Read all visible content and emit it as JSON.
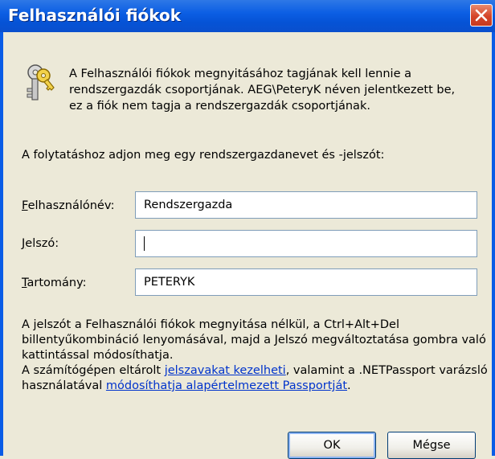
{
  "window": {
    "title": "Felhasználói fiókok"
  },
  "message": "A Felhasználói fiókok megnyitásához tagjának kell lennie a rendszergazdák csoportjának. AEG\\PeteryK néven jelentkezett be, ez a fiók nem tagja a rendszergazdák csoportjának.",
  "prompt": "A folytatáshoz adjon meg egy rendszergazdanevet és -jelszót:",
  "fields": {
    "username": {
      "label_first": "F",
      "label_rest": "elhasználónév:",
      "value": "Rendszergazda"
    },
    "password": {
      "label_first": "J",
      "label_rest": "elszó:",
      "value": ""
    },
    "domain": {
      "label_first": "T",
      "label_rest": "artomány:",
      "value": "PETERYK"
    }
  },
  "info": {
    "line1": "A jelszót a Felhasználói fiókok megnyitása nélkül, a Ctrl+Alt+Del billentyűkombináció lenyomásával, majd a Jelszó megváltoztatása gombra való kattintással módosíthatja.",
    "line2_pre": "A számítógépen eltárolt ",
    "link1": "jelszavakat kezelheti",
    "line2_mid": ", valamint a .NETPassport varázsló használatával ",
    "link2": "módosíthatja alapértelmezett Passportját",
    "line2_post": "."
  },
  "buttons": {
    "ok": "OK",
    "cancel": "Mégse"
  },
  "icons": {
    "keys": "keys-icon",
    "close": "close-icon"
  },
  "colors": {
    "titlebar": "#0553d6",
    "close": "#d5452a",
    "link": "#0033cc",
    "background": "#ece9d8"
  }
}
